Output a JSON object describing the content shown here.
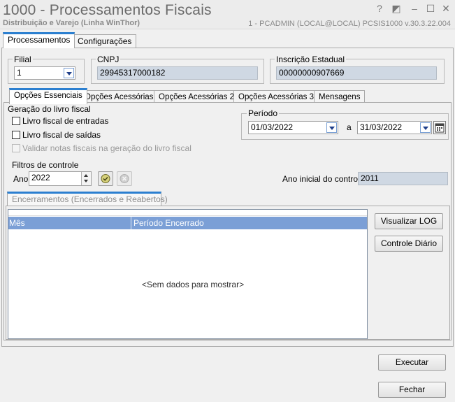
{
  "window": {
    "title": "1000 - Processamentos Fiscais",
    "subtitle": "Distribuição e Varejo (Linha WinThor)",
    "info": "1 - PCADMIN (LOCAL@LOCAL)   PCSIS1000  v.30.3.22.004",
    "controls": [
      "?",
      "◩",
      "–",
      "☐",
      "✕"
    ]
  },
  "top_tabs": [
    "Processamentos",
    "Configurações"
  ],
  "filial": {
    "label": "Filial",
    "value": "1"
  },
  "cnpj": {
    "label": "CNPJ",
    "value": "29945317000182"
  },
  "inscricao": {
    "label": "Inscrição Estadual",
    "value": "00000000907669"
  },
  "sub_tabs": [
    "Opções Essenciais",
    "Opções Acessórias",
    "Opções Acessórias 2",
    "Opções Acessórias 3",
    "Mensagens"
  ],
  "geracao": {
    "title": "Geração do livro fiscal",
    "entradas": "Livro fiscal de entradas",
    "saidas": "Livro fiscal de saídas",
    "validar": "Validar notas fiscais na geração do livro fiscal"
  },
  "periodo": {
    "title": "Período",
    "start": "01/03/2022",
    "separator": "a",
    "end": "31/03/2022"
  },
  "filtros": {
    "title": "Filtros de controle",
    "ano_label": "Ano",
    "ano_value": "2022",
    "ano_inicial_label": "Ano inicial do controle",
    "ano_inicial_value": "2011"
  },
  "encerramentos": {
    "tab": "Encerramentos (Encerrados e Reabertos)",
    "columns": [
      "Mês",
      "Período Encerrado"
    ],
    "empty": "<Sem dados para mostrar>"
  },
  "buttons": {
    "log": "Visualizar LOG",
    "diario": "Controle Diário",
    "executar": "Executar",
    "fechar": "Fechar"
  }
}
